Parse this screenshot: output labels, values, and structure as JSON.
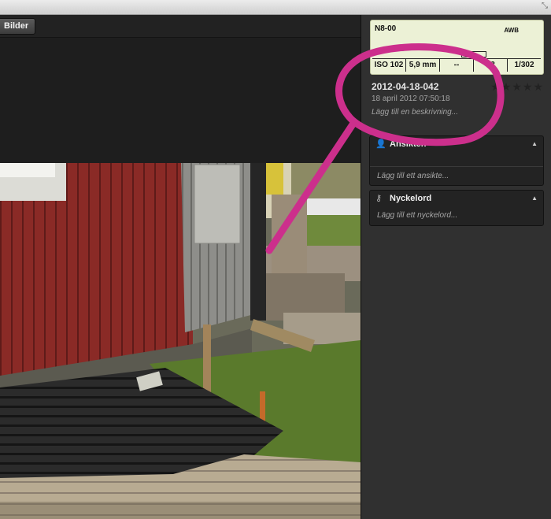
{
  "window": {
    "corner_icon": "resize-icon"
  },
  "toolbar": {
    "bilder_label": "Bilder"
  },
  "info_card": {
    "camera_name": "N8-00",
    "awb": "AWB",
    "exif": [
      "ISO 102",
      "5,9 mm",
      "--",
      "f/2",
      "1/302"
    ]
  },
  "photo_info": {
    "title": "2012-04-18-042",
    "date": "18 april 2012 07:50:18",
    "description_placeholder": "Lägg till en beskrivning...",
    "stars": "★★★★★"
  },
  "faces": {
    "title": "Ansikten",
    "add_label": "Lägg till ett ansikte..."
  },
  "keywords": {
    "title": "Nyckelord",
    "add_label": "Lägg till ett nyckelord..."
  },
  "colors": {
    "annotation": "#cc2f8c",
    "card": "#ecf1d6",
    "panel": "#303030"
  }
}
